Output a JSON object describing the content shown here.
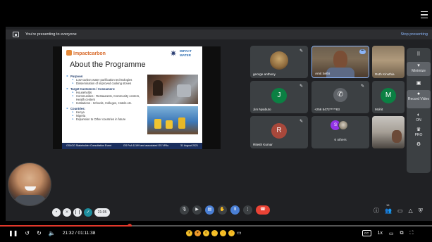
{
  "presenting_bar": {
    "text": "You're presenting to everyone",
    "stop_label": "Stop presenting"
  },
  "slide": {
    "logo_left": "Impactcarbon",
    "logo_right": "IMPACT WATER",
    "title": "About the Programme",
    "sections": [
      {
        "heading": "Purpose:",
        "items": [
          "Low-carbon water purification technologies",
          "Dissemination of improved cooking stoves"
        ]
      },
      {
        "heading": "Target Customers / Consumers:",
        "items": [
          "Households",
          "Communities - Restaurants, Community centers, Health centers",
          "Institutions - Schools, Colleges, Hotels etc."
        ]
      },
      {
        "heading": "Countries:",
        "items": [
          "Kenya",
          "Nigeria",
          "Expansion to Other countries in future"
        ]
      }
    ],
    "footer": {
      "left": "GS4GG Stakeholder Consultation Event",
      "middle": "GS PoA 11199 and associated GS VPAs",
      "right": "31 August 2021"
    }
  },
  "participants": [
    {
      "name": "george anthony",
      "type": "photo"
    },
    {
      "name": "Amit Sethi",
      "type": "video",
      "active": true
    },
    {
      "name": "Ruth Kinuthia",
      "type": "video"
    },
    {
      "name": "Jim Nyabuto",
      "type": "initial",
      "initial": "J",
      "color": "#0b8043"
    },
    {
      "name": "+256 5472*****83",
      "type": "phone"
    },
    {
      "name": "Mohit",
      "type": "initial",
      "initial": "M",
      "color": "#0b8043"
    },
    {
      "name": "Ritesh Kumar",
      "type": "initial",
      "initial": "R",
      "color": "#a8483b"
    },
    {
      "name": "6 others",
      "type": "others",
      "initial": "S"
    },
    {
      "name": "",
      "type": "video"
    }
  ],
  "extension_panel": {
    "items": [
      {
        "icon": "grid-icon",
        "label": ""
      },
      {
        "icon": "minimize-icon",
        "label": "Minimize"
      },
      {
        "icon": "chat-icon",
        "label": ""
      },
      {
        "icon": "record-icon",
        "label": "Record Video"
      },
      {
        "icon": "toggle-icon",
        "label": "ON"
      },
      {
        "icon": "crown-icon",
        "label": "PRO"
      },
      {
        "icon": "settings-icon",
        "label": ""
      }
    ]
  },
  "self_controls": {
    "time": "21:35"
  },
  "meet_controls": {
    "participant_count": "15"
  },
  "player": {
    "current_time": "21:32",
    "total_time": "01:11:38",
    "progress": 0.3,
    "speed": "1x",
    "cc": "CC"
  },
  "colors": {
    "meet_bg": "#202124",
    "tile_bg": "#3c4043",
    "accent": "#8ab4f8",
    "end_call": "#ea4335",
    "progress": "#e1382b"
  }
}
